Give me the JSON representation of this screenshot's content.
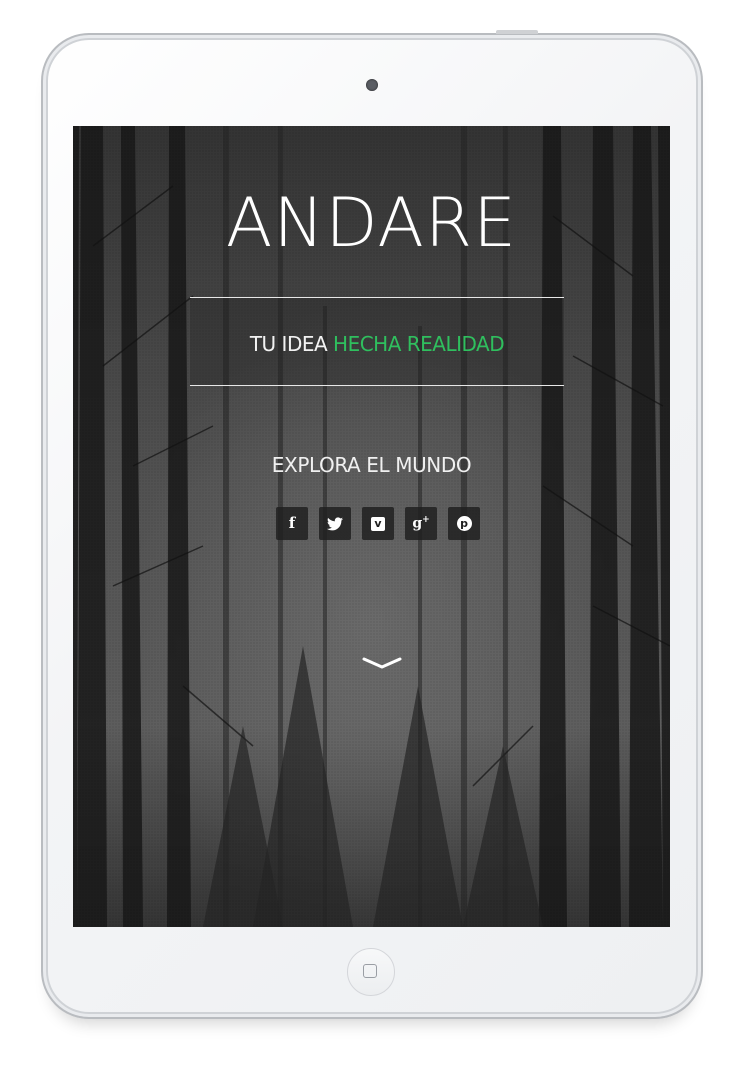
{
  "hero": {
    "title": "ANDARE",
    "tagline_part1": "TU IDEA ",
    "tagline_part2": "HECHA REALIDAD",
    "tagline_accent_color": "#2fbf5e",
    "explore": "EXPLORA EL MUNDO"
  },
  "social": {
    "items": [
      {
        "name": "facebook-icon",
        "glyph": "f"
      },
      {
        "name": "twitter-icon",
        "glyph": "bird"
      },
      {
        "name": "vimeo-icon",
        "glyph": "v"
      },
      {
        "name": "google-plus-icon",
        "glyph": "g+"
      },
      {
        "name": "pinterest-icon",
        "glyph": "p"
      }
    ]
  },
  "scroll": {
    "icon": "chevron-down-icon"
  },
  "device": {
    "frame_color": "#f3f4f6",
    "screen_background": "forest photograph, grayscale"
  }
}
